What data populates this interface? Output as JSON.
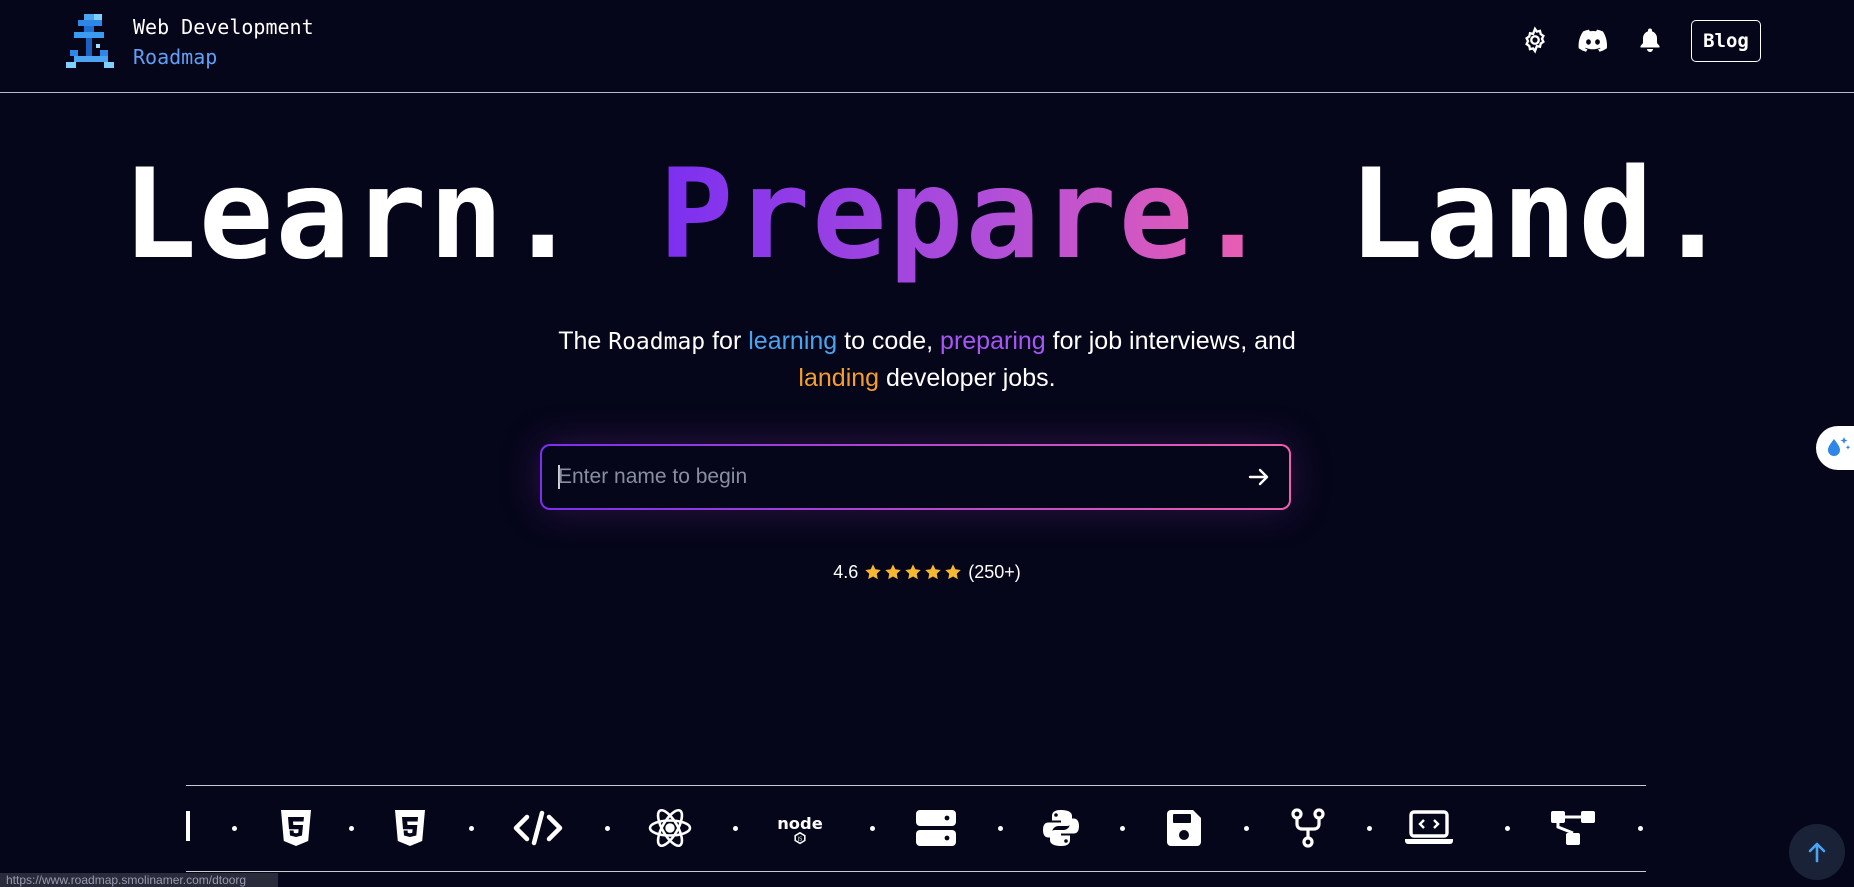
{
  "brand": {
    "line1": "Web Development",
    "line2": "Roadmap",
    "accent_color": "#5fa0f6"
  },
  "header": {
    "icons": [
      "gear-icon",
      "discord-icon",
      "bell-icon"
    ],
    "blog_label": "Blog"
  },
  "hero": {
    "word1": "Learn.",
    "word2": "Prepare.",
    "word3": "Land."
  },
  "subtitle": {
    "p1": "The ",
    "p2": "Roadmap",
    "p3": " for ",
    "learning": "learning",
    "p4": " to code, ",
    "preparing": "preparing",
    "p5": " for job interviews, and",
    "landing": "landing",
    "p6": " developer jobs."
  },
  "search": {
    "placeholder": "Enter name to begin",
    "value": ""
  },
  "rating": {
    "score": "4.6",
    "stars": 5,
    "count": "(250+)"
  },
  "tech_strip": {
    "icons": [
      "html5-icon",
      "css3-icon",
      "code-icon",
      "react-icon",
      "nodejs-icon",
      "server-icon",
      "python-icon",
      "floppy-disk-icon",
      "git-branch-icon",
      "laptop-code-icon",
      "sitemap-icon"
    ]
  },
  "status_bar": {
    "url": "https://www.roadmap.smolinamer.com/dtoorg"
  },
  "colors": {
    "background": "#05061a",
    "gradient_start": "#7b2ff0",
    "gradient_end": "#ee5fae",
    "learning": "#4aa4f0",
    "preparing": "#a855f7",
    "landing": "#f59e2b",
    "star": "#f5b82e"
  }
}
